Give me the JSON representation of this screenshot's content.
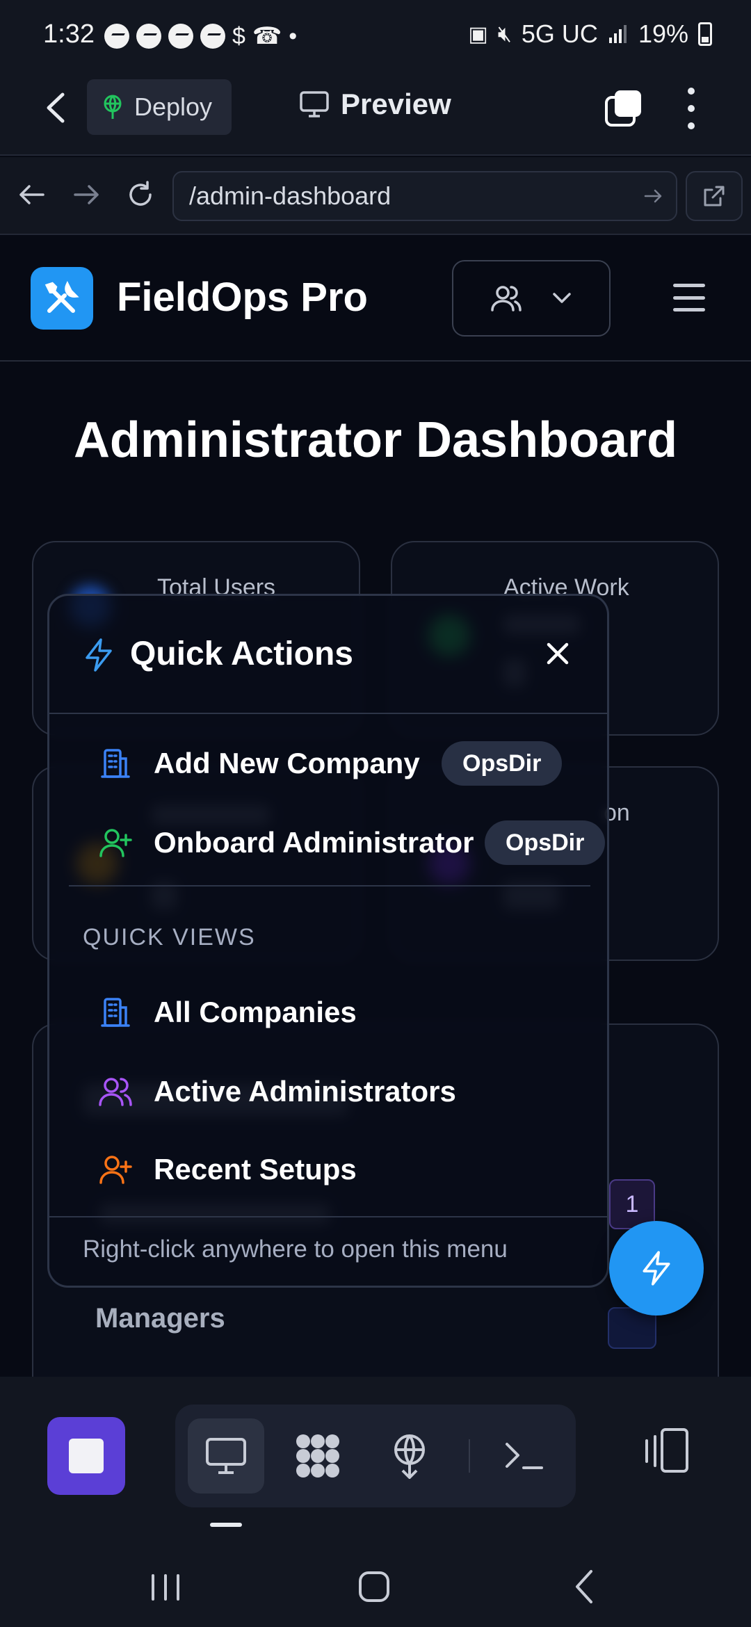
{
  "status_bar": {
    "time": "1:32",
    "network": "5G UC",
    "battery": "19%"
  },
  "app_bar": {
    "deploy_label": "Deploy",
    "preview_label": "Preview"
  },
  "url_bar": {
    "url": "/admin-dashboard"
  },
  "site": {
    "brand": "FieldOps Pro",
    "page_title": "Administrator Dashboard",
    "accent_color": "#2196f3"
  },
  "background_cards": {
    "total_users_label": "Total Users",
    "active_work_label": "Active Work",
    "partial_label": "on",
    "managers_label": "Managers",
    "badge_count": "1"
  },
  "quick_actions": {
    "title": "Quick Actions",
    "actions": [
      {
        "label": "Add New Company",
        "badge": "OpsDir",
        "icon": "building-icon",
        "color": "#3b82f6"
      },
      {
        "label": "Onboard Administrator",
        "badge": "OpsDir",
        "icon": "user-plus-icon",
        "color": "#22c55e"
      }
    ],
    "section_label": "QUICK VIEWS",
    "views": [
      {
        "label": "All Companies",
        "icon": "building-icon",
        "color": "#3b82f6"
      },
      {
        "label": "Active Administrators",
        "icon": "users-icon",
        "color": "#a855f7"
      },
      {
        "label": "Recent Setups",
        "icon": "user-plus-icon",
        "color": "#f97316"
      }
    ],
    "footer_hint": "Right-click anywhere to open this menu"
  }
}
